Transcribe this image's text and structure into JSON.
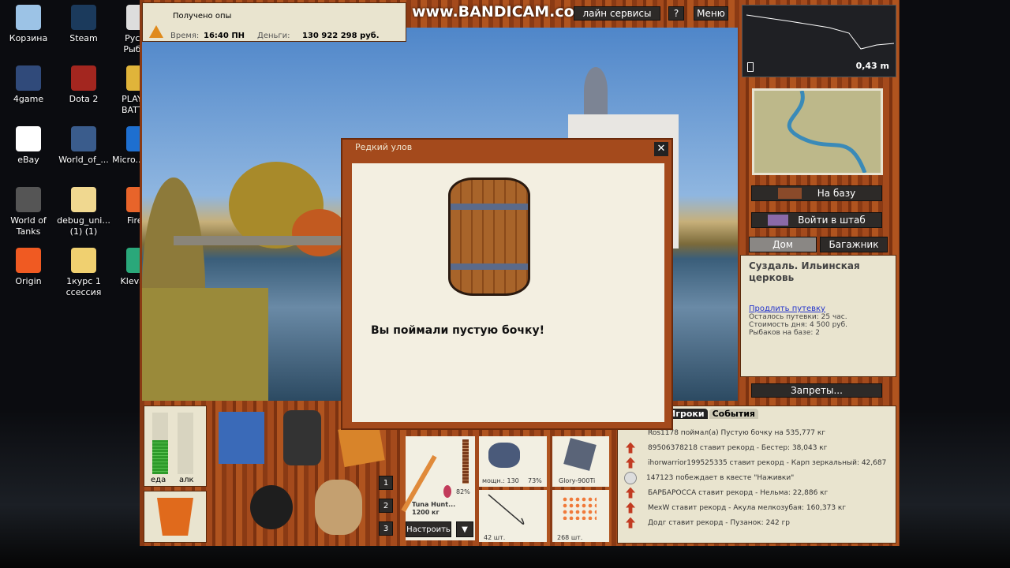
{
  "desktop": {
    "icons": [
      {
        "label": "Корзина",
        "color": "#9cc3e6"
      },
      {
        "label": "Steam",
        "color": "#1b3a5c"
      },
      {
        "label": "Русс... Рыба...",
        "color": "#ddd"
      },
      {
        "label": "4game",
        "color": "#304a7a"
      },
      {
        "label": "Dota 2",
        "color": "#a3261f"
      },
      {
        "label": "PLAYE... BATTL...",
        "color": "#e0b43a"
      },
      {
        "label": "eBay",
        "color": "#ffffff"
      },
      {
        "label": "World_of_...",
        "color": "#3a5c8c"
      },
      {
        "label": "Micro... Ed...",
        "color": "#1e6fd0"
      },
      {
        "label": "World of Tanks",
        "color": "#555"
      },
      {
        "label": "debug_uni... (1) (1)",
        "color": "#f0d890"
      },
      {
        "label": "Fire...",
        "color": "#e8642a"
      },
      {
        "label": "Origin",
        "color": "#f05a22"
      },
      {
        "label": "1курс 1 ссессия",
        "color": "#f0d070"
      },
      {
        "label": "Klevall...",
        "color": "#2aa87a"
      }
    ]
  },
  "watermark": "www.BANDICAM.com",
  "status": {
    "message": "Получено опы",
    "time_label": "Время:",
    "time": "16:40 ПН",
    "money_label": "Деньги:",
    "money": "130 922 298 руб."
  },
  "topbar": {
    "services": "лайн сервисы",
    "help": "?",
    "menu": "Меню"
  },
  "depth": {
    "value": "0,43 m"
  },
  "dialog": {
    "title": "Редкий улов",
    "message": "Вы поймали пустую бочку!",
    "close": "✕"
  },
  "right": {
    "to_base": "На базу",
    "hq": "Войти в штаб",
    "tab_home": "Дом",
    "tab_trunk": "Багажник",
    "location": "Суздаль. Ильинская церковь",
    "extend": "Продлить путевку",
    "info": [
      "Осталось путевки: 25 час.",
      "Стоимость дня: 4 500 руб.",
      "Рыбаков на базе: 2"
    ],
    "bans": "Запреты..."
  },
  "meters": {
    "food": "еда",
    "alcohol": "алк",
    "food_level": 0.55,
    "alcohol_level": 0
  },
  "hotkeys": [
    "1",
    "2",
    "3"
  ],
  "tackle": {
    "rod_name": "Tuna Hunt...",
    "rod_load": "1200 кг",
    "float_pct": "82%",
    "reel_power": "мощн.: 130",
    "reel_pct": "73%",
    "line": "Glory-900Ti",
    "hooks": "42 шт.",
    "bait": "268 шт.",
    "setup": "Настроить",
    "more": "▼"
  },
  "events": {
    "tabs": [
      "Игроки",
      "События"
    ],
    "items": [
      {
        "icon": "none",
        "text": "Ros1178 поймал(а) Пустую бочку на 535,777 кг"
      },
      {
        "icon": "record",
        "text": "89506378218 ставит рекорд - Бестер: 38,043 кг"
      },
      {
        "icon": "record",
        "text": "ihorwarrior199525335 ставит рекорд - Карп зеркальный: 42,687"
      },
      {
        "icon": "clock",
        "text": "147123 побеждает в квесте \"Наживки\""
      },
      {
        "icon": "record",
        "text": "БАРБАРОССА ставит рекорд - Нельма: 22,886 кг"
      },
      {
        "icon": "record",
        "text": "MexW ставит рекорд - Акула мелкозубая: 160,373 кг"
      },
      {
        "icon": "record",
        "text": "Додг ставит рекорд - Пузанок: 242 гр"
      }
    ]
  }
}
